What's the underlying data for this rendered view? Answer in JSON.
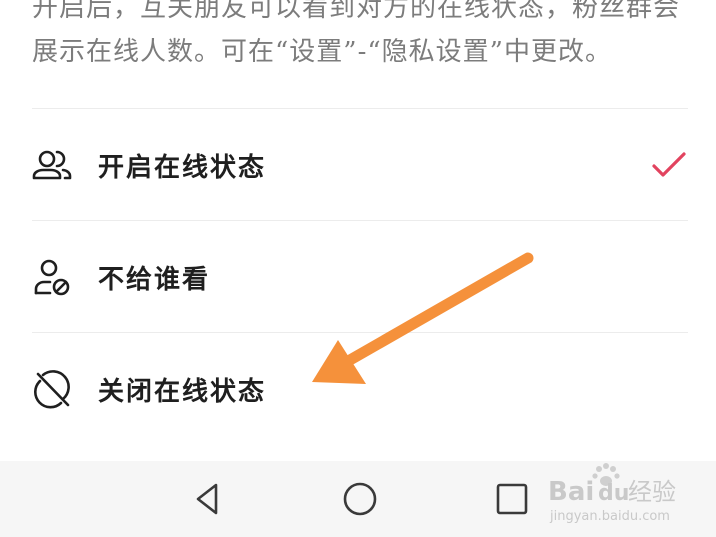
{
  "description": {
    "line1": "开启后，互关朋友可以看到对方的在线状态，粉丝群会",
    "line2": "展示在线人数。可在“设置”-“隐私设置”中更改。"
  },
  "options": [
    {
      "label": "开启在线状态",
      "icon": "friends-icon",
      "selected": true
    },
    {
      "label": "不给谁看",
      "icon": "user-block-icon",
      "selected": false
    },
    {
      "label": "关闭在线状态",
      "icon": "offline-icon",
      "selected": false
    }
  ],
  "colors": {
    "accent": "#e2435f",
    "arrow": "#f5913b",
    "text": "#1f1f1f",
    "desc": "#7c7c7c",
    "navbar": "#f6f6f6"
  },
  "navbar": {
    "buttons": [
      "back-icon",
      "home-icon",
      "recents-icon"
    ]
  },
  "watermark": {
    "brand": "Bai",
    "brand2": "du",
    "suffix": "经验",
    "url": "jingyan.baidu.com"
  }
}
